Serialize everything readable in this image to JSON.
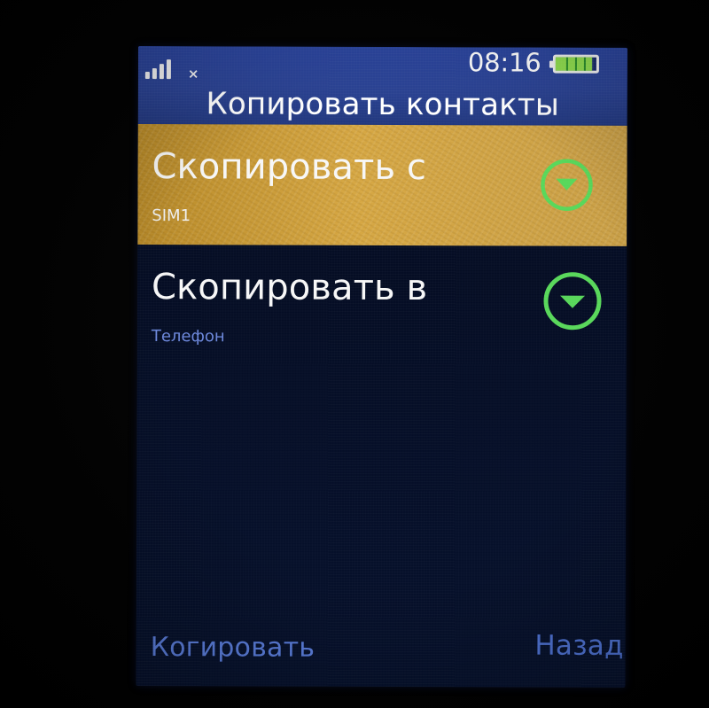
{
  "status_bar": {
    "signal_icon": "signal-bars-icon",
    "data_icon": "no-data-x-icon",
    "time": "08:16",
    "battery_icon": "battery-icon",
    "battery_level": 1.0,
    "colors": {
      "header": "#2b4394",
      "battery_fill": "#91df4f"
    }
  },
  "header": {
    "title": "Копировать контакты"
  },
  "menu": {
    "items": [
      {
        "label": "Скопировать с",
        "value": "SIM1",
        "selected": true,
        "icon": "chevron-down-circle-icon"
      },
      {
        "label": "Скопировать в",
        "value": "Телефон",
        "selected": false,
        "icon": "chevron-down-circle-icon"
      }
    ]
  },
  "softkeys": {
    "left": "Когировать",
    "right": "Назад",
    "color": "#5b7fe0"
  },
  "colors": {
    "background": "#06112d",
    "selected_row": "#d6a743",
    "accent": "#58d75a"
  }
}
